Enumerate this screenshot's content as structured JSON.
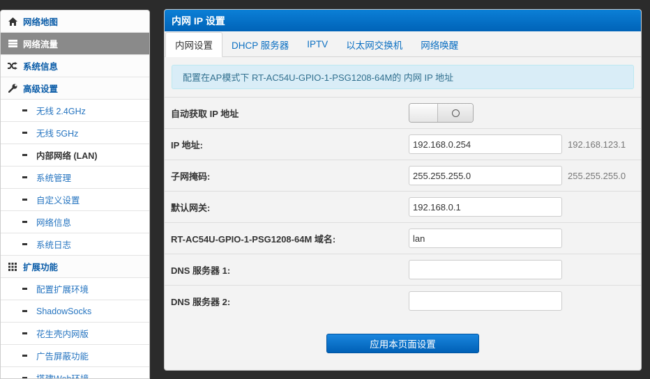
{
  "sidebar": {
    "items": [
      {
        "label": "网络地图",
        "icon": "home-icon"
      },
      {
        "label": "网络流量",
        "icon": "traffic-icon"
      },
      {
        "label": "系统信息",
        "icon": "shuffle-icon"
      },
      {
        "label": "高级设置",
        "icon": "wrench-icon"
      }
    ],
    "advanced_sub": [
      "无线 2.4GHz",
      "无线 5GHz",
      "内部网络 (LAN)",
      "系统管理",
      "自定义设置",
      "网络信息",
      "系统日志"
    ],
    "extensions": {
      "label": "扩展功能",
      "icon": "grid-icon"
    },
    "extensions_sub": [
      "配置扩展环境",
      "ShadowSocks",
      "花生壳内网版",
      "广告屏蔽功能",
      "搭建Web环境"
    ]
  },
  "panel": {
    "title": "内网 IP 设置",
    "tabs": [
      "内网设置",
      "DHCP 服务器",
      "IPTV",
      "以太网交换机",
      "网络唤醒"
    ],
    "notice": "配置在AP模式下 RT-AC54U-GPIO-1-PSG1208-64M的 内网 IP 地址"
  },
  "form": {
    "auto_ip_label": "自动获取 IP 地址",
    "ip_label": "IP 地址:",
    "ip_value": "192.168.0.254",
    "ip_hint": "192.168.123.1",
    "mask_label": "子网掩码:",
    "mask_value": "255.255.255.0",
    "mask_hint": "255.255.255.0",
    "gateway_label": "默认网关:",
    "gateway_value": "192.168.0.1",
    "domain_label": "RT-AC54U-GPIO-1-PSG1208-64M 域名:",
    "domain_value": "lan",
    "dns1_label": "DNS 服务器 1:",
    "dns1_value": "",
    "dns2_label": "DNS 服务器 2:",
    "dns2_value": ""
  },
  "apply_label": "应用本页面设置"
}
